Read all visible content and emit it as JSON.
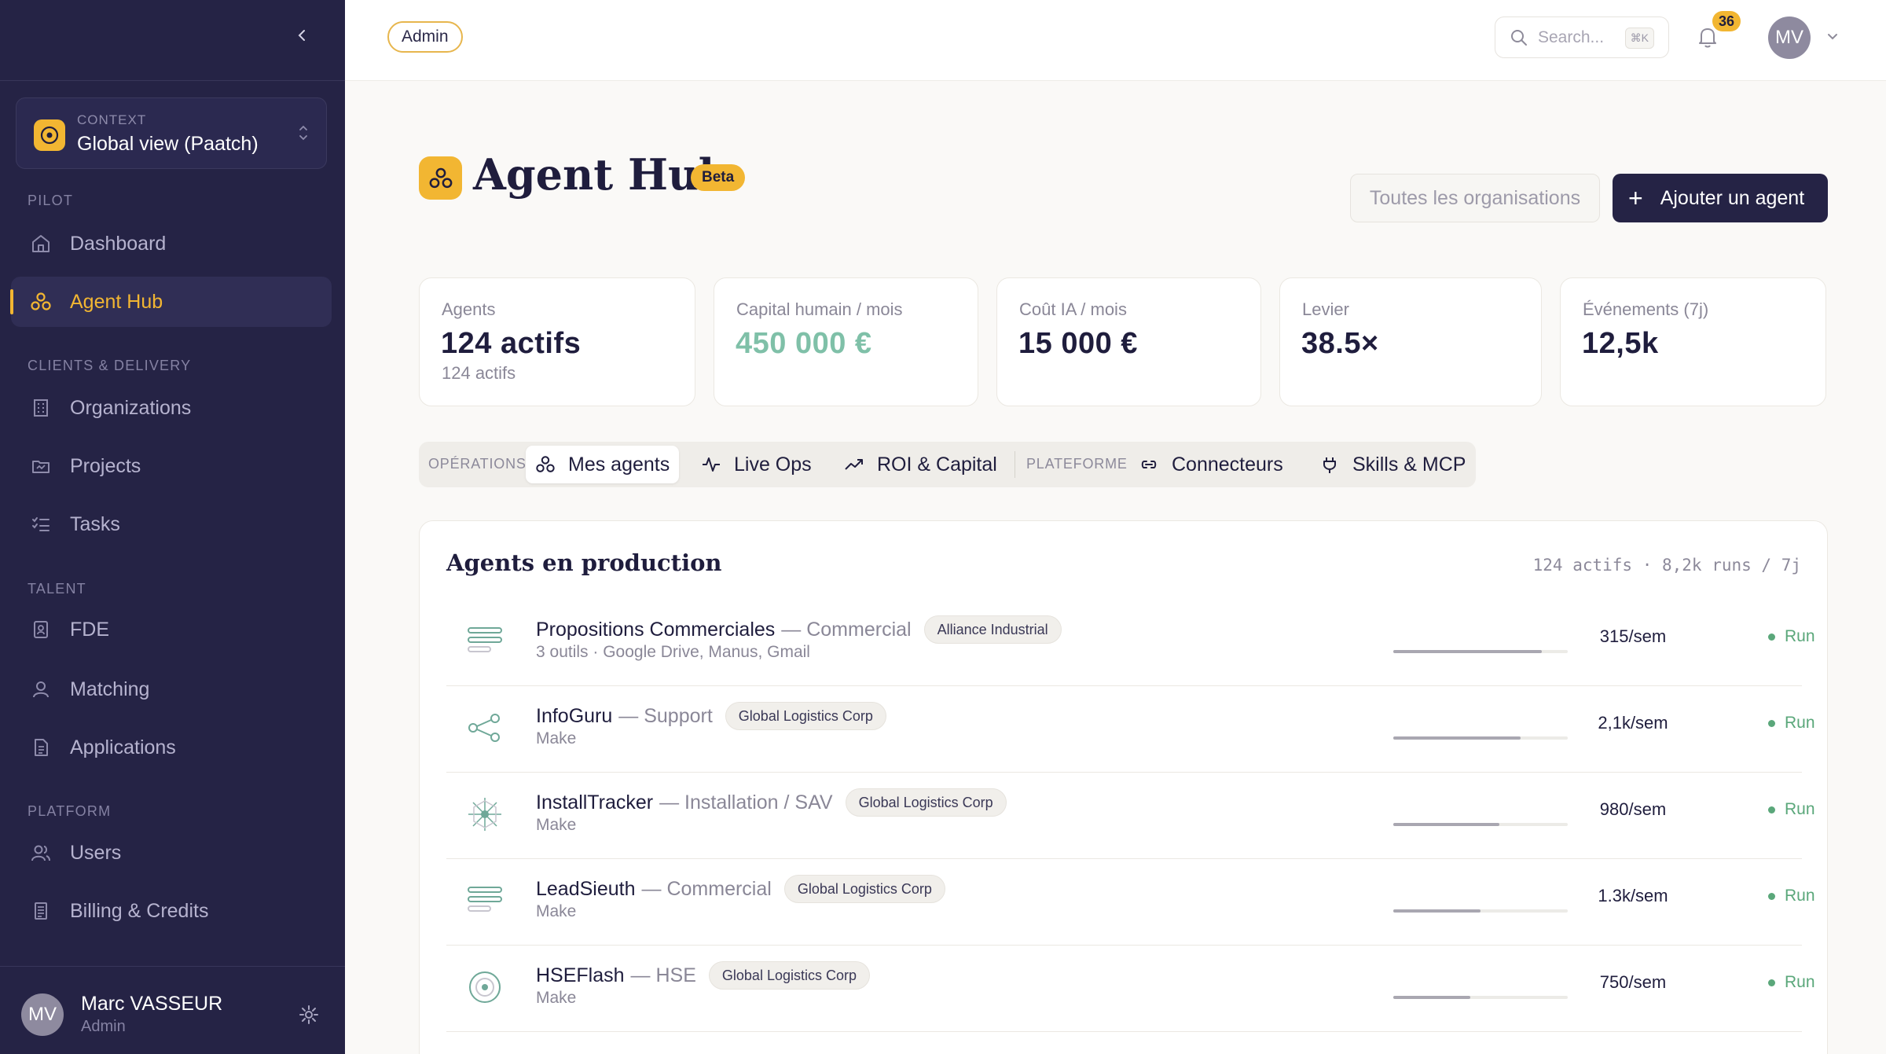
{
  "sidebar": {
    "context_label": "CONTEXT",
    "context_value": "Global view (Paatch)",
    "sections": {
      "pilot": "PILOT",
      "clients": "CLIENTS & DELIVERY",
      "talent": "TALENT",
      "platform": "PLATFORM"
    },
    "items": [
      {
        "label": "Dashboard",
        "icon": "home-icon"
      },
      {
        "label": "Agent Hub",
        "icon": "agent-hub-icon",
        "active": true
      },
      {
        "label": "Organizations",
        "icon": "building-icon"
      },
      {
        "label": "Projects",
        "icon": "folder-icon"
      },
      {
        "label": "Tasks",
        "icon": "tasks-icon"
      },
      {
        "label": "FDE",
        "icon": "id-card-icon"
      },
      {
        "label": "Matching",
        "icon": "user-icon"
      },
      {
        "label": "Applications",
        "icon": "document-icon"
      },
      {
        "label": "Users",
        "icon": "users-icon"
      },
      {
        "label": "Billing & Credits",
        "icon": "receipt-icon"
      }
    ],
    "user": {
      "initials": "MV",
      "name": "Marc VASSEUR",
      "role": "Admin"
    }
  },
  "topbar": {
    "role_badge": "Admin",
    "search_placeholder": "Search...",
    "search_shortcut": "⌘K",
    "notification_count": "36",
    "avatar_initials": "MV"
  },
  "header": {
    "title": "Agent Hub",
    "badge": "Beta",
    "org_filter": "Toutes les organisations",
    "add_button": "Ajouter un agent"
  },
  "stats": [
    {
      "label": "Agents",
      "value": "124 actifs",
      "sub": "124 actifs"
    },
    {
      "label": "Capital humain / mois",
      "value": "450 000 €",
      "sub": ""
    },
    {
      "label": "Coût IA / mois",
      "value": "15 000 €",
      "sub": ""
    },
    {
      "label": "Levier",
      "value": "38.5×",
      "sub": ""
    },
    {
      "label": "Événements (7j)",
      "value": "12,5k",
      "sub": ""
    }
  ],
  "tabs": {
    "section_ops": "OPÉRATIONS",
    "section_platform": "PLATEFORME",
    "items": [
      {
        "label": "Mes agents",
        "active": true
      },
      {
        "label": "Live Ops"
      },
      {
        "label": "ROI & Capital"
      },
      {
        "label": "Connecteurs"
      },
      {
        "label": "Skills & MCP"
      }
    ]
  },
  "table": {
    "title": "Agents en production",
    "meta": "124 actifs · 8,2k runs / 7j",
    "rows": [
      {
        "name": "Propositions Commerciales",
        "dept": "— Commercial",
        "org": "Alliance Industrial",
        "sub": "3 outils · Google Drive, Manus, Gmail",
        "rate": "315/sem",
        "status": "Run",
        "load": 0.85,
        "icon": "layers-icon"
      },
      {
        "name": "InfoGuru",
        "dept": "— Support",
        "org": "Global Logistics Corp",
        "sub": "Make",
        "rate": "2,1k/sem",
        "status": "Run",
        "load": 0.73,
        "icon": "share-nodes-icon"
      },
      {
        "name": "InstallTracker",
        "dept": "— Installation / SAV",
        "org": "Global Logistics Corp",
        "sub": "Make",
        "rate": "980/sem",
        "status": "Run",
        "load": 0.61,
        "icon": "network-icon"
      },
      {
        "name": "LeadSieuth",
        "dept": "— Commercial",
        "org": "Global Logistics Corp",
        "sub": "Make",
        "rate": "1.3k/sem",
        "status": "Run",
        "load": 0.5,
        "icon": "layers-icon"
      },
      {
        "name": "HSEFlash",
        "dept": "— HSE",
        "org": "Global Logistics Corp",
        "sub": "Make",
        "rate": "750/sem",
        "status": "Run",
        "load": 0.44,
        "icon": "target-icon"
      }
    ]
  },
  "colors": {
    "sidebar_bg": "#252345",
    "accent": "#f2b632",
    "status_green": "#5aa77a",
    "capital_value": "#7fc0a8"
  }
}
